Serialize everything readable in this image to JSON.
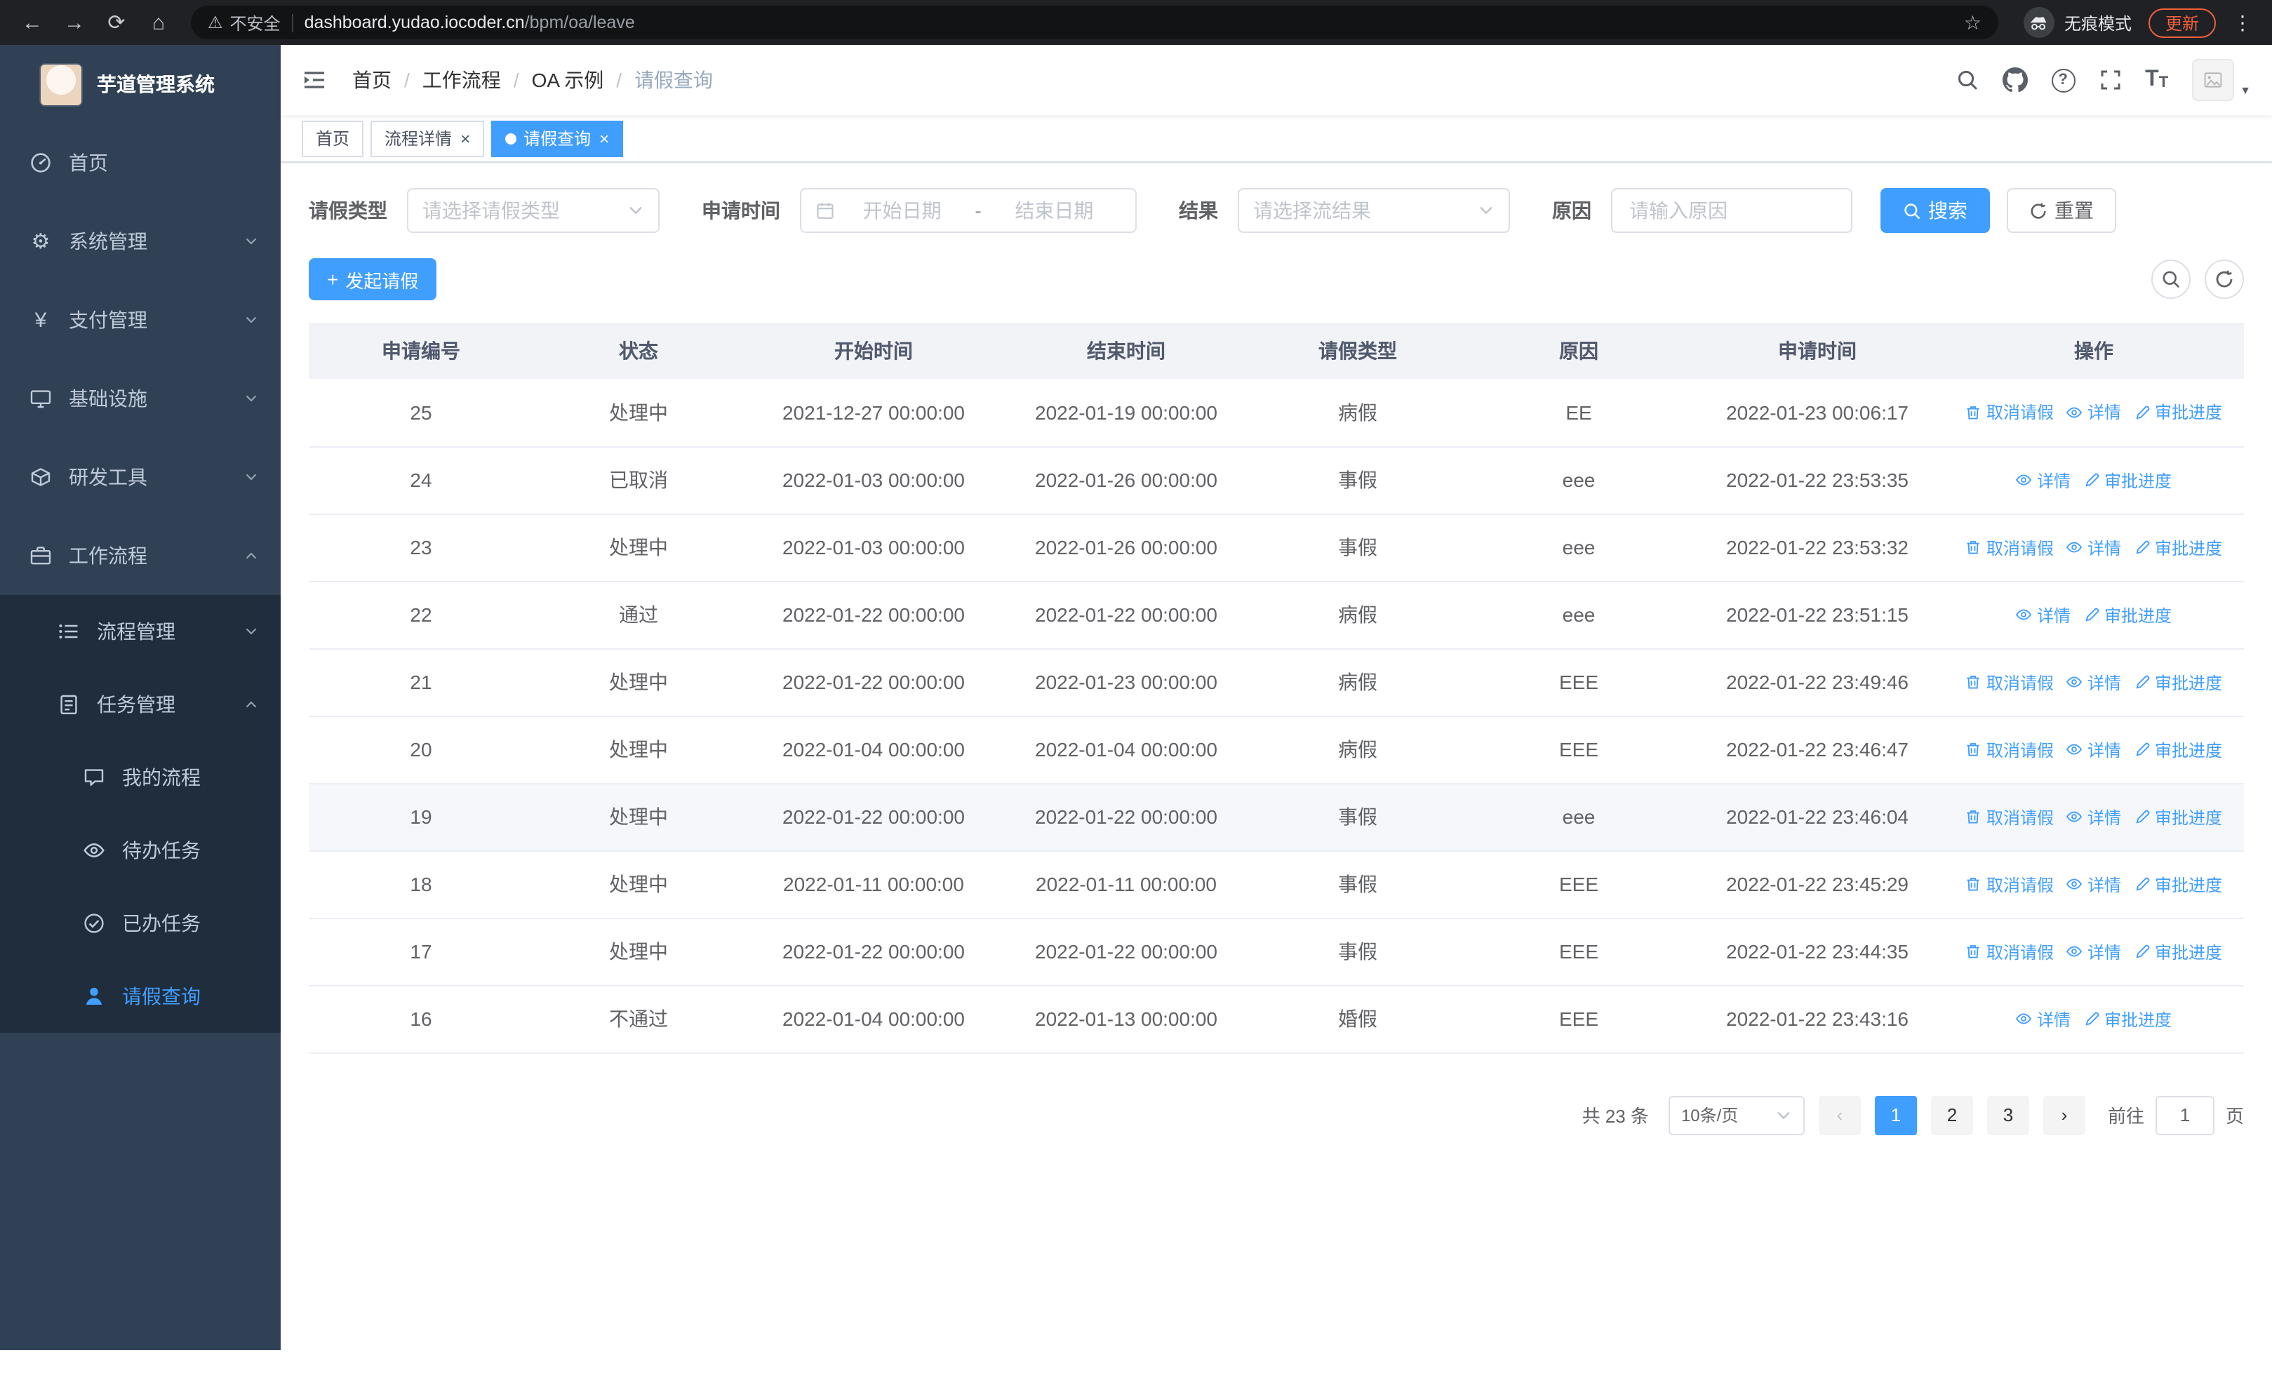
{
  "browser": {
    "security_label": "不安全",
    "url_domain": "dashboard.yudao.iocoder.cn",
    "url_path": "/bpm/oa/leave",
    "incognito_label": "无痕模式",
    "update_label": "更新"
  },
  "icons": {
    "back": "←",
    "forward": "→",
    "reload": "⟳",
    "home": "⌂",
    "warning": "⚠",
    "star": "☆",
    "dots": "⋮",
    "gear": "⚙",
    "yen": "¥",
    "close": "×",
    "caret_down": "▼",
    "question": "?",
    "font_large": "T",
    "font_small": "T",
    "plus": "+",
    "prev": "‹",
    "next": "›"
  },
  "colors": {
    "accent": "#409eff",
    "sidebar_bg": "#304156",
    "submenu_bg": "#1f2d3d",
    "update_accent": "#f0603c",
    "table_header_bg": "#f1f3f6"
  },
  "sidebar": {
    "app_title": "芋道管理系统",
    "top_items": [
      "首页",
      "系统管理",
      "支付管理",
      "基础设施",
      "研发工具",
      "工作流程"
    ],
    "workflow_children": [
      "流程管理",
      "任务管理"
    ],
    "task_children": [
      "我的流程",
      "待办任务",
      "已办任务",
      "请假查询"
    ]
  },
  "breadcrumb": {
    "sep": "/",
    "items": [
      "首页",
      "工作流程",
      "OA 示例",
      "请假查询"
    ]
  },
  "tabs": [
    "首页",
    "流程详情",
    "请假查询"
  ],
  "filters": {
    "leave_type_label": "请假类型",
    "leave_type_placeholder": "请选择请假类型",
    "apply_time_label": "申请时间",
    "start_date_placeholder": "开始日期",
    "range_separator": "-",
    "end_date_placeholder": "结束日期",
    "result_label": "结果",
    "result_placeholder": "请选择流结果",
    "reason_label": "原因",
    "reason_placeholder": "请输入原因",
    "search_label": "搜索",
    "reset_label": "重置"
  },
  "toolbar": {
    "create_label": "发起请假"
  },
  "table": {
    "columns": [
      "申请编号",
      "状态",
      "开始时间",
      "结束时间",
      "请假类型",
      "原因",
      "申请时间",
      "操作"
    ],
    "actions": {
      "cancel": "取消请假",
      "detail": "详情",
      "progress": "审批进度"
    },
    "rows": [
      {
        "id": "25",
        "status": "处理中",
        "start": "2021-12-27 00:00:00",
        "end": "2022-01-19 00:00:00",
        "type": "病假",
        "reason": "EE",
        "applied": "2022-01-23 00:06:17"
      },
      {
        "id": "24",
        "status": "已取消",
        "start": "2022-01-03 00:00:00",
        "end": "2022-01-26 00:00:00",
        "type": "事假",
        "reason": "eee",
        "applied": "2022-01-22 23:53:35"
      },
      {
        "id": "23",
        "status": "处理中",
        "start": "2022-01-03 00:00:00",
        "end": "2022-01-26 00:00:00",
        "type": "事假",
        "reason": "eee",
        "applied": "2022-01-22 23:53:32"
      },
      {
        "id": "22",
        "status": "通过",
        "start": "2022-01-22 00:00:00",
        "end": "2022-01-22 00:00:00",
        "type": "病假",
        "reason": "eee",
        "applied": "2022-01-22 23:51:15"
      },
      {
        "id": "21",
        "status": "处理中",
        "start": "2022-01-22 00:00:00",
        "end": "2022-01-23 00:00:00",
        "type": "病假",
        "reason": "EEE",
        "applied": "2022-01-22 23:49:46"
      },
      {
        "id": "20",
        "status": "处理中",
        "start": "2022-01-04 00:00:00",
        "end": "2022-01-04 00:00:00",
        "type": "病假",
        "reason": "EEE",
        "applied": "2022-01-22 23:46:47"
      },
      {
        "id": "19",
        "status": "处理中",
        "start": "2022-01-22 00:00:00",
        "end": "2022-01-22 00:00:00",
        "type": "事假",
        "reason": "eee",
        "applied": "2022-01-22 23:46:04"
      },
      {
        "id": "18",
        "status": "处理中",
        "start": "2022-01-11 00:00:00",
        "end": "2022-01-11 00:00:00",
        "type": "事假",
        "reason": "EEE",
        "applied": "2022-01-22 23:45:29"
      },
      {
        "id": "17",
        "status": "处理中",
        "start": "2022-01-22 00:00:00",
        "end": "2022-01-22 00:00:00",
        "type": "事假",
        "reason": "EEE",
        "applied": "2022-01-22 23:44:35"
      },
      {
        "id": "16",
        "status": "不通过",
        "start": "2022-01-04 00:00:00",
        "end": "2022-01-13 00:00:00",
        "type": "婚假",
        "reason": "EEE",
        "applied": "2022-01-22 23:43:16"
      }
    ]
  },
  "pagination": {
    "total": "共 23 条",
    "page_size": "10条/页",
    "pages": [
      "1",
      "2",
      "3"
    ],
    "goto_label": "前往",
    "goto_value": "1",
    "unit_label": "页"
  }
}
